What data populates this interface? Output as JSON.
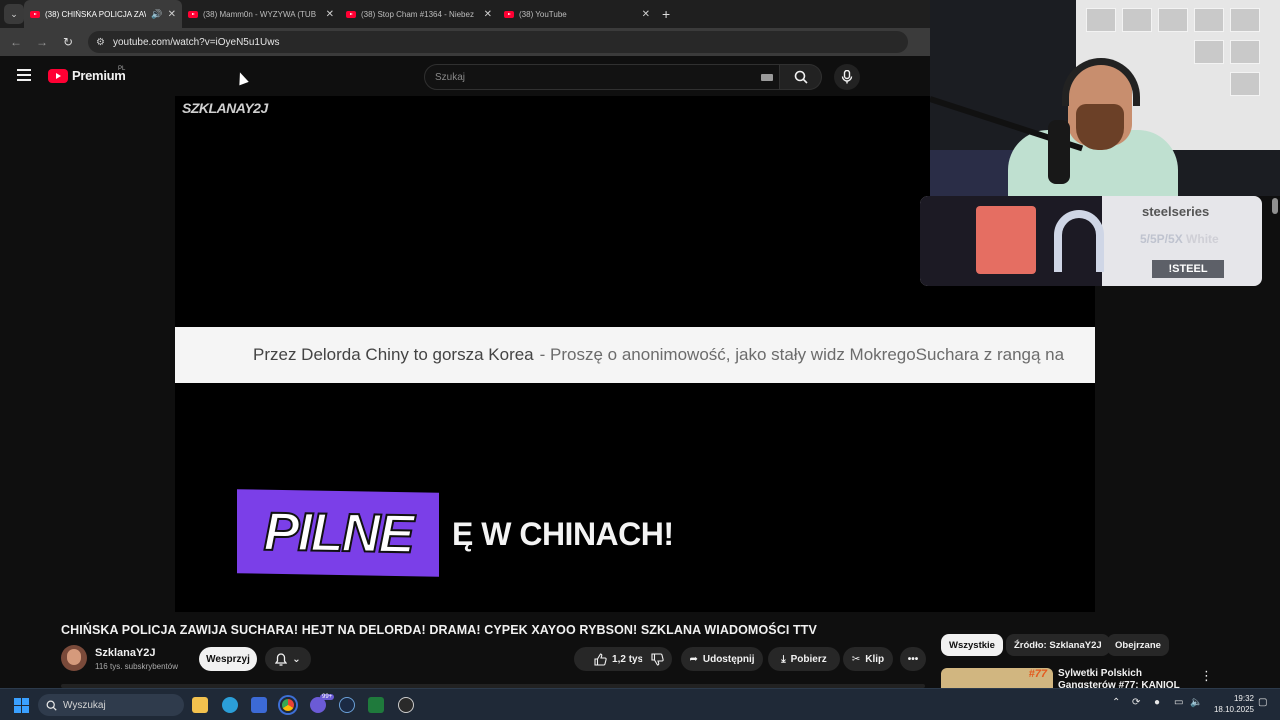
{
  "browser": {
    "tabs": [
      {
        "title": "(38) CHIŃSKA POLICJA ZAWIJA",
        "active": true
      },
      {
        "title": "(38) Mamm0n - WYZYWA (TUB",
        "active": false
      },
      {
        "title": "(38) Stop Cham #1364 - Niebez",
        "active": false
      },
      {
        "title": "(38) YouTube",
        "active": false
      }
    ],
    "new_tab_icon": "+",
    "url": "youtube.com/watch?v=iOyeN5u1Uws"
  },
  "youtube": {
    "logo_text": "Premium",
    "logo_country": "PL",
    "search_placeholder": "Szukaj"
  },
  "video": {
    "channel_watermark": "SZKLANAY2J",
    "ticker_lead": "Przez Delorda Chiny to gorsza Korea",
    "ticker_rest": "- Proszę o anonimowość, jako stały widz MokregoSuchara z rangą na",
    "badge_text": "PILNE",
    "headline_fragment": "Ę W CHINACH!",
    "title": "CHIŃSKA POLICJA ZAWIJA SUCHARA! HEJT NA DELORDA! DRAMA! CYPEK XAYOO RYBSON! SZKLANA WIADOMOŚCI TTV"
  },
  "sponsor": {
    "brand": "steelseries",
    "model_prefix": "5/5P/5X",
    "model_color": "White",
    "command": "!STEEL"
  },
  "channel": {
    "name": "SzklanaY2J",
    "subscribers": "116 tys. subskrybentów",
    "support_label": "Wesprzyj"
  },
  "actions": {
    "likes": "1,2 tys.",
    "share": "Udostępnij",
    "download": "Pobierz",
    "clip": "Klip"
  },
  "chips": [
    "Wszystkie",
    "Źródło: SzklanaY2J",
    "Obejrzane"
  ],
  "recommendation": {
    "title": "Sylwetki Polskich Gangsterów #77: KANIOL",
    "thumb_number": "#77"
  },
  "taskbar": {
    "search_label": "Wyszukaj",
    "discord_badge": "99+",
    "time": "19:32",
    "date": "18.10.2025"
  },
  "colors": {
    "youtube_red": "#ff0033",
    "pilne_purple": "#7b3fe8",
    "background": "#0f0f0f"
  }
}
